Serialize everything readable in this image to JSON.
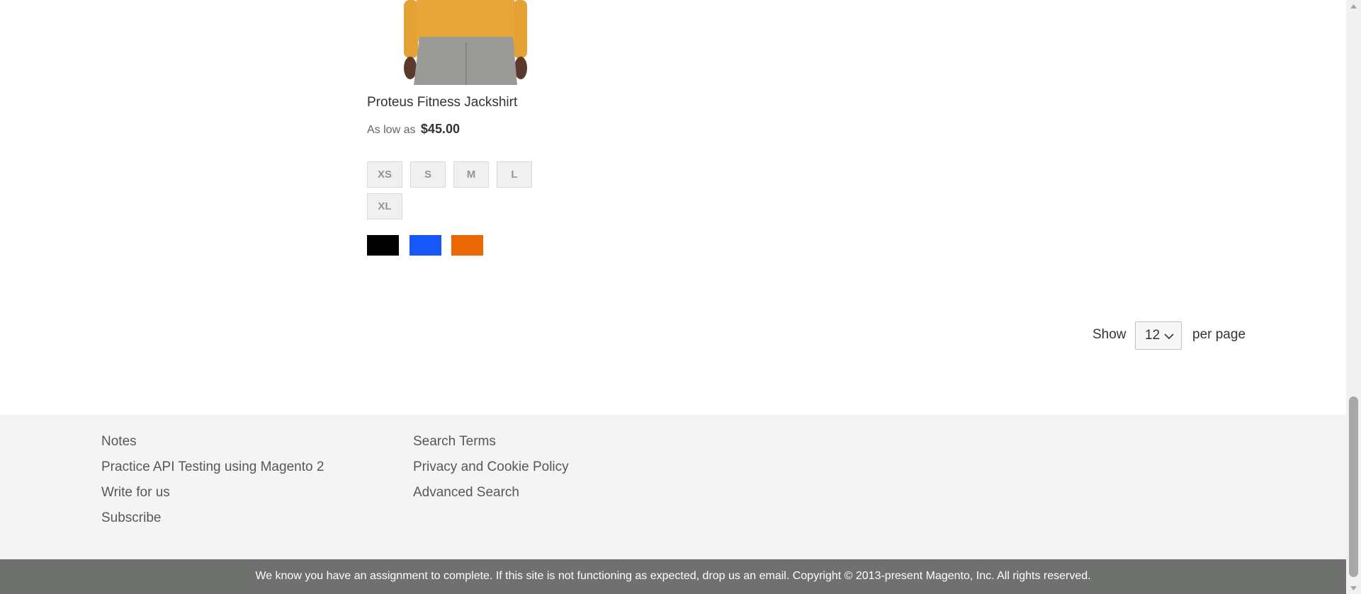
{
  "product": {
    "name": "Proteus Fitness Jackshirt",
    "price_prefix": "As low as",
    "price": "$45.00",
    "sizes": [
      "XS",
      "S",
      "M",
      "L",
      "XL"
    ],
    "colors": [
      {
        "name": "Black",
        "hex": "#000000"
      },
      {
        "name": "Blue",
        "hex": "#1857f7"
      },
      {
        "name": "Orange",
        "hex": "#eb6703"
      }
    ]
  },
  "toolbar": {
    "show_label": "Show",
    "limit_value": "12",
    "per_page_label": "per page"
  },
  "footer": {
    "col1": [
      "Notes",
      "Practice API Testing using Magento 2",
      "Write for us",
      "Subscribe"
    ],
    "col2": [
      "Search Terms",
      "Privacy and Cookie Policy",
      "Advanced Search"
    ],
    "copyright": "We know you have an assignment to complete. If this site is not functioning as expected, drop us an email. Copyright © 2013-present Magento, Inc. All rights reserved."
  },
  "icons": {
    "chevron": "chevron-down-icon",
    "scroll_up": "scroll-up-arrow-icon",
    "scroll_down": "scroll-down-arrow-icon"
  }
}
